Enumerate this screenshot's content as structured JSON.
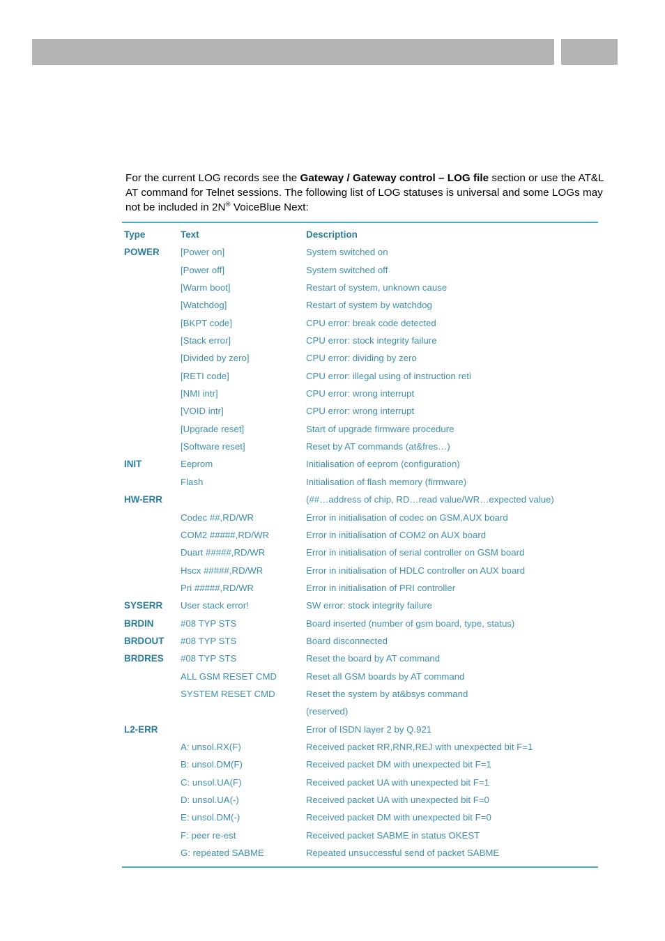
{
  "header": {
    "left_block": "",
    "right_block": ""
  },
  "intro": {
    "part1": "For the current LOG records see the ",
    "bold": "Gateway / Gateway control – LOG file",
    "part2": " section or use the AT&L AT command for Telnet sessions. The following list of LOG statuses is universal and some LOGs may not be included in 2N",
    "superscript": "®",
    "part3": " VoiceBlue Next:"
  },
  "table": {
    "columns": [
      "Type",
      "Text",
      "Description"
    ],
    "rows": [
      {
        "type": "POWER",
        "text": "[Power on]",
        "desc": "System switched on"
      },
      {
        "type": "",
        "text": "[Power off]",
        "desc": "System switched off"
      },
      {
        "type": "",
        "text": "[Warm boot]",
        "desc": "Restart of system, unknown cause"
      },
      {
        "type": "",
        "text": "[Watchdog]",
        "desc": "Restart of system by watchdog"
      },
      {
        "type": "",
        "text": "[BKPT code]",
        "desc": "CPU error: break code detected"
      },
      {
        "type": "",
        "text": "[Stack error]",
        "desc": "CPU error: stock integrity failure"
      },
      {
        "type": "",
        "text": "[Divided by zero]",
        "desc": "CPU error: dividing by zero"
      },
      {
        "type": "",
        "text": "[RETI code]",
        "desc": "CPU error: illegal using of instruction reti"
      },
      {
        "type": "",
        "text": "[NMI intr]",
        "desc": "CPU error: wrong interrupt"
      },
      {
        "type": "",
        "text": "[VOID intr]",
        "desc": "CPU error: wrong interrupt"
      },
      {
        "type": "",
        "text": "[Upgrade reset]",
        "desc": "Start of upgrade firmware procedure"
      },
      {
        "type": "",
        "text": "[Software reset]",
        "desc": "Reset by AT commands (at&fres…)"
      },
      {
        "type": "INIT",
        "text": "Eeprom",
        "desc": "Initialisation of eeprom (configuration)"
      },
      {
        "type": "",
        "text": "Flash",
        "desc": "Initialisation of flash memory (firmware)"
      },
      {
        "type": "HW-ERR",
        "text": "",
        "desc": "(##…address of chip, RD…read value/WR…expected value)"
      },
      {
        "type": "",
        "text": "Codec ##,RD/WR",
        "desc": "Error in initialisation of codec on GSM,AUX board"
      },
      {
        "type": "",
        "text": "COM2 #####,RD/WR",
        "desc": "Error in initialisation of COM2 on AUX board"
      },
      {
        "type": "",
        "text": "Duart #####,RD/WR",
        "desc": "Error in initialisation of serial controller on GSM board"
      },
      {
        "type": "",
        "text": "Hscx #####,RD/WR",
        "desc": "Error in initialisation of HDLC controller on AUX board"
      },
      {
        "type": "",
        "text": "Pri #####,RD/WR",
        "desc": "Error in initialisation of PRI controller"
      },
      {
        "type": "SYSERR",
        "text": "User stack error!",
        "desc": "SW error: stock integrity failure"
      },
      {
        "type": "BRDIN",
        "text": "#08 TYP STS",
        "desc": "Board inserted (number of gsm board, type, status)"
      },
      {
        "type": "BRDOUT",
        "text": "#08 TYP STS",
        "desc": "Board disconnected"
      },
      {
        "type": "BRDRES",
        "text": "#08 TYP STS",
        "desc": "Reset the board by AT command"
      },
      {
        "type": "",
        "text": "ALL GSM RESET CMD",
        "desc": "Reset all GSM boards by AT command"
      },
      {
        "type": "",
        "text": "SYSTEM RESET CMD",
        "desc": "Reset the system by at&bsys command"
      },
      {
        "type": "",
        "text": "",
        "desc": "(reserved)"
      },
      {
        "type": "L2-ERR",
        "text": "",
        "desc": "Error of ISDN layer 2 by Q.921"
      },
      {
        "type": "",
        "text": "A: unsol.RX(F)",
        "desc": "Received packet RR,RNR,REJ with unexpected bit F=1"
      },
      {
        "type": "",
        "text": "B: unsol.DM(F)",
        "desc": "Received packet DM with unexpected bit F=1"
      },
      {
        "type": "",
        "text": "C: unsol.UA(F)",
        "desc": "Received packet UA with unexpected bit F=1"
      },
      {
        "type": "",
        "text": "D: unsol.UA(-)",
        "desc": "Received packet UA with unexpected bit F=0"
      },
      {
        "type": "",
        "text": "E: unsol.DM(-)",
        "desc": "Received packet DM with unexpected bit F=0"
      },
      {
        "type": "",
        "text": "F: peer re-est",
        "desc": "Received packet SABME in status OKEST"
      },
      {
        "type": "",
        "text": "G: repeated SABME",
        "desc": "Repeated unsuccessful send of packet SABME"
      }
    ]
  },
  "colors": {
    "header_band": "#b3b3b3",
    "rule": "#4aaac4",
    "heading_text": "#2a7d9c",
    "body_text": "#3d8faf",
    "paragraph_text": "#000000"
  }
}
